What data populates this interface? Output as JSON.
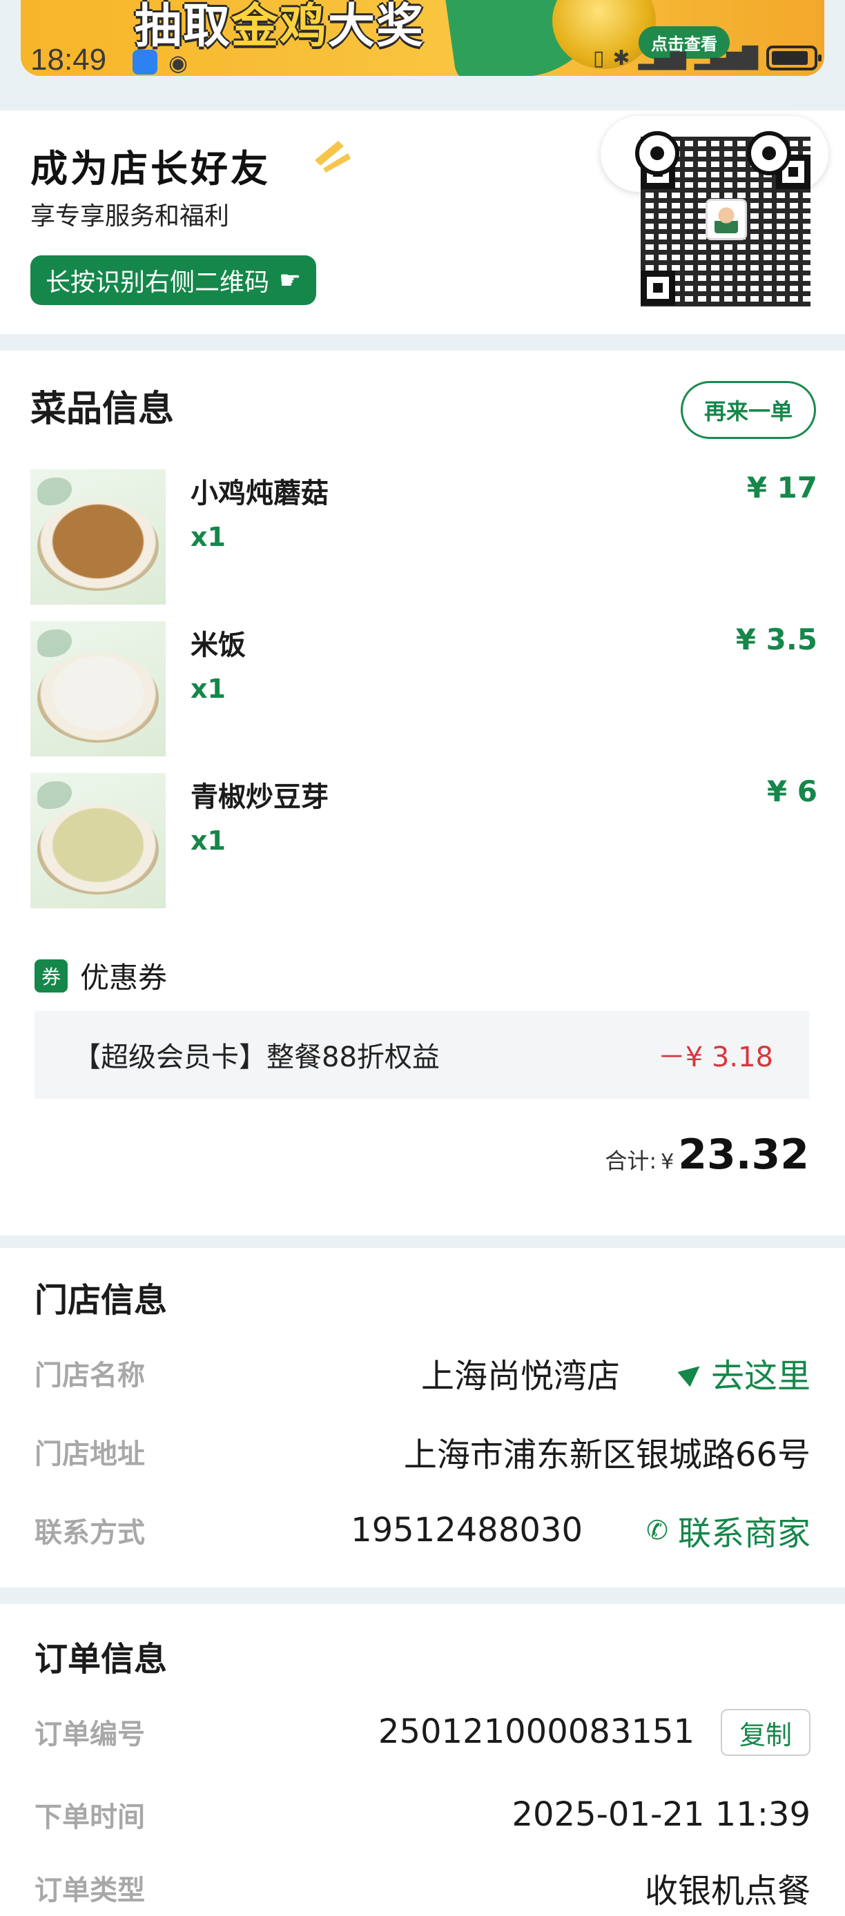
{
  "status_bar": {
    "time": "18:49"
  },
  "banner": {
    "headline_pre": "抽取",
    "headline_gold": "金鸡",
    "headline_post": "大奖",
    "cta": "点击查看"
  },
  "friend_card": {
    "title": "成为店长好友",
    "subtitle": "享专享服务和福利",
    "button_label": "长按识别右侧二维码"
  },
  "dishes_section": {
    "title": "菜品信息",
    "reorder_label": "再来一单",
    "items": [
      {
        "name": "小鸡炖蘑菇",
        "qty": "x1",
        "price": "¥ 17",
        "food_color": "#b07a3e"
      },
      {
        "name": "米饭",
        "qty": "x1",
        "price": "¥ 3.5",
        "food_color": "#f4f2ec"
      },
      {
        "name": "青椒炒豆芽",
        "qty": "x1",
        "price": "¥ 6",
        "food_color": "#d9d6a2"
      }
    ],
    "coupon_tag": "券",
    "coupon_label": "优惠券",
    "coupon_name": "【超级会员卡】整餐88折权益",
    "coupon_amount": "－¥ 3.18",
    "total_label": "合计:",
    "total_currency": "¥",
    "total_value": "23.32"
  },
  "store_section": {
    "title": "门店信息",
    "rows": [
      {
        "label": "门店名称",
        "value": "上海尚悦湾店",
        "link": "去这里"
      },
      {
        "label": "门店地址",
        "value": "上海市浦东新区银城路66号"
      },
      {
        "label": "联系方式",
        "value": "19512488030",
        "link": "联系商家"
      }
    ]
  },
  "order_section": {
    "title": "订单信息",
    "rows": [
      {
        "label": "订单编号",
        "value": "250121000083151",
        "action": "复制"
      },
      {
        "label": "下单时间",
        "value": "2025-01-21 11:39"
      },
      {
        "label": "订单类型",
        "value": "收银机点餐"
      }
    ]
  },
  "colors": {
    "brand_green": "#15874a",
    "discount_red": "#d9363e",
    "label_gray": "#a8a8a8"
  }
}
